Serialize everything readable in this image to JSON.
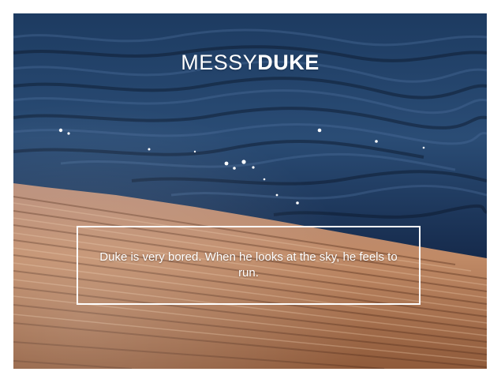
{
  "brand": {
    "light_part": "MESSY",
    "bold_part": "DUKE"
  },
  "caption": {
    "text": "Duke is very bored. When he looks at the sky, he feels to run."
  },
  "colors": {
    "water_deep": "#0e1f36",
    "water_mid": "#1f3d63",
    "wood_light": "#c99a72",
    "wood_dark": "#8a5a3c",
    "text": "#ffffff"
  }
}
